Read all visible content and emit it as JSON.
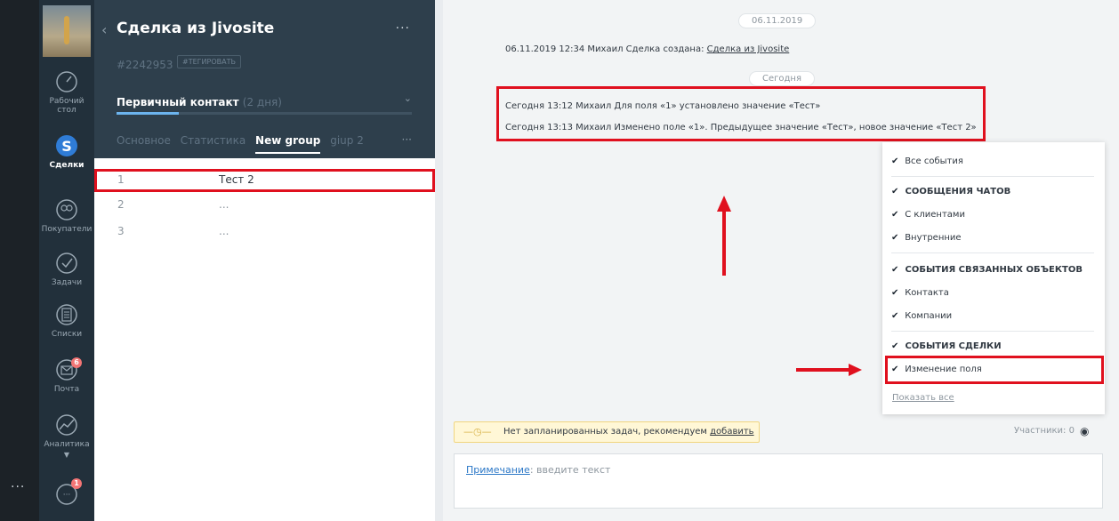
{
  "nav": {
    "items": [
      {
        "label": "Рабочий стол",
        "icon": "dashboard-icon"
      },
      {
        "label": "Сделки",
        "icon": "deals-dollar-icon"
      },
      {
        "label": "Покупатели",
        "icon": "customers-icon"
      },
      {
        "label": "Задачи",
        "icon": "tasks-check-icon"
      },
      {
        "label": "Списки",
        "icon": "lists-icon"
      },
      {
        "label": "Почта",
        "icon": "mail-icon",
        "badge": "6"
      },
      {
        "label": "Аналитика",
        "icon": "analytics-icon"
      }
    ],
    "chat_badge": "1",
    "more": "···"
  },
  "card": {
    "title": "Сделка из Jivosite",
    "back": "‹",
    "more": "···",
    "id": "#2242953",
    "tag_button": "#ТЕГИРОВАТЬ",
    "stage": "Первичный контакт",
    "stage_duration": "(2 дня)",
    "stage_chevron": "⌄",
    "tabs": [
      "Основное",
      "Статистика",
      "New group",
      "giup 2"
    ],
    "active_tab": "New group",
    "tabs_more": "···"
  },
  "fields": [
    {
      "key": "1",
      "value": "Тест 2"
    },
    {
      "key": "2",
      "value": "..."
    },
    {
      "key": "3",
      "value": "..."
    }
  ],
  "feed": {
    "date1": "06.11.2019",
    "event1": {
      "text": "06.11.2019 12:34 Михаил  Сделка создана: ",
      "link": "Сделка из Jivosite"
    },
    "today": "Сегодня",
    "event2": "Сегодня 13:12 Михаил  Для поля «1» установлено значение «Тест»",
    "event3": "Сегодня 13:13 Михаил  Изменено поле «1». Предыдущее значение «Тест», новое значение «Тест 2»"
  },
  "filter": {
    "all": "Все события",
    "chats_head": "СООБЩЕНИЯ ЧАТОВ",
    "chats_clients": "С клиентами",
    "chats_internal": "Внутренние",
    "linked_head": "СОБЫТИЯ СВЯЗАННЫХ ОБЪЕКТОВ",
    "linked_contact": "Контакта",
    "linked_company": "Компании",
    "deal_head": "СОБЫТИЯ СДЕЛКИ",
    "deal_field": "Изменение поля",
    "show_all": "Показать все",
    "check": "✔"
  },
  "bottom": {
    "task_text": "Нет запланированных задач, рекомендуем ",
    "task_link": "добавить",
    "members": "Участники: 0",
    "note_label": "Примечание",
    "note_placeholder": ": введите текст"
  },
  "colors": {
    "highlight": "#e0101e",
    "nav_bg": "#22303b",
    "card_bg": "#2e3f4c",
    "accent": "#6cb4ee"
  }
}
